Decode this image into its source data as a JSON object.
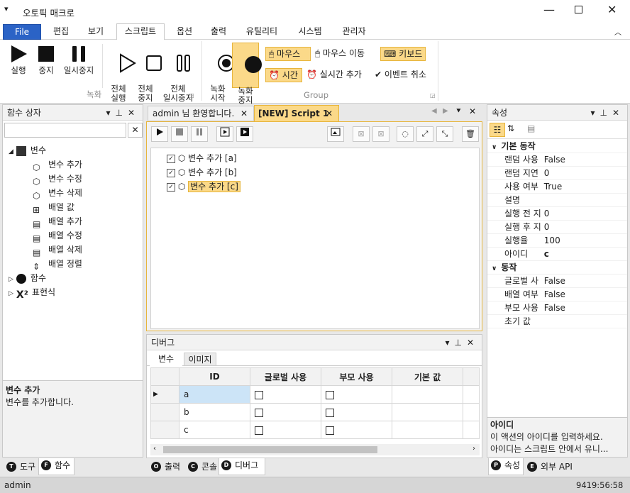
{
  "app": {
    "title": "오토픽 매크로"
  },
  "menu": {
    "tabs": [
      "File",
      "편집",
      "보기",
      "스크립트",
      "옵션",
      "출력",
      "유틸리티",
      "시스템",
      "관리자"
    ],
    "active": 3
  },
  "ribbon": {
    "rec_group": {
      "play": "실행",
      "stop": "중지",
      "pause": "일시중지",
      "play_all": "전체\n실행",
      "stop_all": "전체\n중지",
      "pause_all": "전체\n일시중지",
      "label": "녹화"
    },
    "group2": {
      "rec_start": "녹화\n시작",
      "rec_stop": "녹화\n중지",
      "mouse": "마우스",
      "mouse_move": "마우스 이동",
      "keyboard": "키보드",
      "time": "시간",
      "realtime_add": "실시간 추가",
      "event_cancel": "이벤트 취소",
      "label": "Group"
    }
  },
  "left_panel": {
    "title": "함수 상자",
    "search_value": "",
    "tree": [
      {
        "label": "변수",
        "level": 0,
        "expanded": true,
        "icon": "variable-icon"
      },
      {
        "label": "변수 추가",
        "level": 1,
        "icon": "cube-icon"
      },
      {
        "label": "변수 수정",
        "level": 1,
        "icon": "cube-icon"
      },
      {
        "label": "변수 삭제",
        "level": 1,
        "icon": "cube-icon"
      },
      {
        "label": "배열 값",
        "level": 1,
        "icon": "array-icon"
      },
      {
        "label": "배열 추가",
        "level": 1,
        "icon": "array-add-icon"
      },
      {
        "label": "배열 수정",
        "level": 1,
        "icon": "array-edit-icon"
      },
      {
        "label": "배열 삭제",
        "level": 1,
        "icon": "array-delete-icon"
      },
      {
        "label": "배열 정렬",
        "level": 1,
        "icon": "sort-icon"
      },
      {
        "label": "함수",
        "level": 0,
        "expanded": false,
        "icon": "function-icon"
      },
      {
        "label": "표현식",
        "level": 0,
        "expanded": false,
        "icon": "expression-icon"
      }
    ],
    "desc_title": "변수 추가",
    "desc_text": "변수를 추가합니다.",
    "bottom_tabs": [
      "도구",
      "함수"
    ]
  },
  "doc_tabs": {
    "tab1": "admin 님 환영합니다.",
    "tab2": "[NEW] Script 1"
  },
  "script": {
    "lines": [
      "변수 추가 [a]",
      "변수 추가 [b]",
      "변수 추가 [c]"
    ]
  },
  "debug": {
    "title": "디버그",
    "tabs": [
      "변수",
      "이미지"
    ],
    "columns": [
      "ID",
      "글로벌 사용",
      "부모 사용",
      "기본 값"
    ],
    "rows": [
      {
        "id": "a"
      },
      {
        "id": "b"
      },
      {
        "id": "c"
      }
    ],
    "bottom_tabs": [
      "출력",
      "콘솔",
      "디버그"
    ]
  },
  "props": {
    "title": "속성",
    "sections": [
      {
        "name": "기본 동작",
        "items": [
          [
            "랜덤 사용",
            "False"
          ],
          [
            "랜덤 지연",
            "0"
          ],
          [
            "사용 여부",
            "True"
          ],
          [
            "설명",
            ""
          ],
          [
            "실행 전 지",
            "0"
          ],
          [
            "실행 후 지",
            "0"
          ],
          [
            "실행율",
            "100"
          ],
          [
            "아이디",
            "c"
          ]
        ]
      },
      {
        "name": "동작",
        "items": [
          [
            "글로벌 사",
            "False"
          ],
          [
            "배열 여부",
            "False"
          ],
          [
            "부모 사용",
            "False"
          ],
          [
            "초기 값",
            ""
          ]
        ]
      }
    ],
    "desc_title": "아이디",
    "desc_text1": "이 액션의 아이디를 입력하세요.",
    "desc_text2": "아이디는 스크립트 안에서 유니...",
    "bottom_tabs": [
      "속성",
      "외부 API"
    ]
  },
  "status": {
    "user": "admin",
    "time": "9419:56:58"
  },
  "colors": {
    "accent": "#2b63c6",
    "highlight": "#fbd989",
    "selection": "#cce4f7"
  }
}
